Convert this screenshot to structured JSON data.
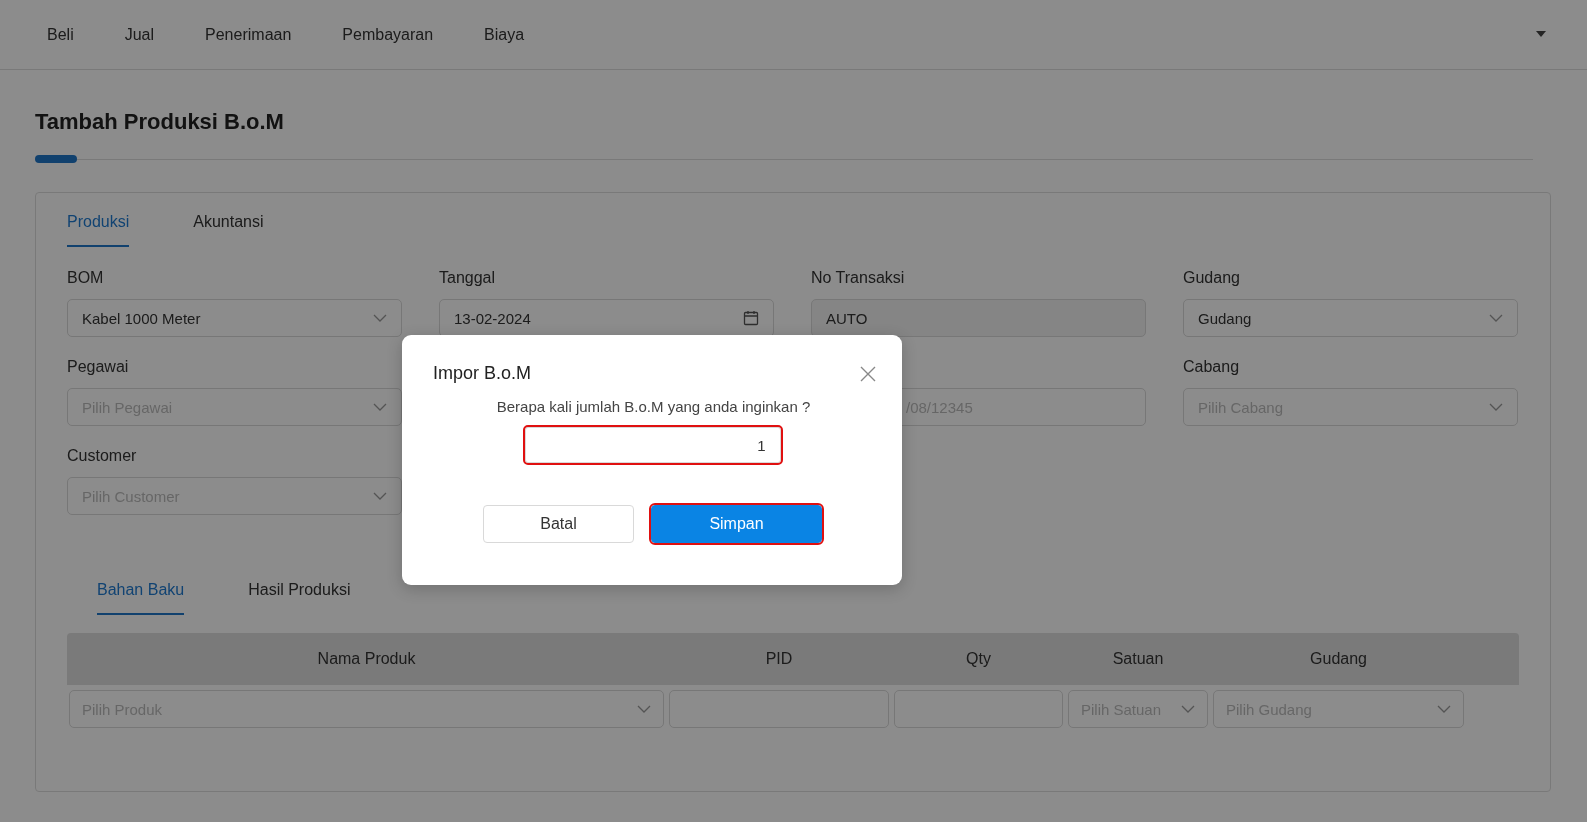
{
  "nav": {
    "items": [
      "Beli",
      "Jual",
      "Penerimaan",
      "Pembayaran",
      "Biaya"
    ]
  },
  "page": {
    "title": "Tambah Produksi B.o.M"
  },
  "form_tabs": [
    {
      "label": "Produksi",
      "selected": true
    },
    {
      "label": "Akuntansi",
      "selected": false
    }
  ],
  "field_rows": [
    [
      {
        "label": "BOM",
        "kind": "select",
        "value": "Kabel 1000 Meter"
      },
      {
        "label": "Tanggal",
        "kind": "date",
        "value": "13-02-2024"
      },
      {
        "label": "No Transaksi",
        "kind": "readonly",
        "value": "AUTO"
      },
      {
        "label": "Gudang",
        "kind": "select",
        "value": "Gudang"
      }
    ],
    [
      {
        "label": "Pegawai",
        "kind": "select",
        "placeholder": "Pilih Pegawai"
      },
      {
        "kind": "covered"
      },
      {
        "kind": "text",
        "placeholder": "/08/12345"
      },
      {
        "label": "Cabang",
        "kind": "select",
        "placeholder": "Pilih Cabang"
      }
    ],
    [
      {
        "label": "Customer",
        "kind": "select",
        "placeholder": "Pilih Customer"
      },
      {
        "kind": "covered"
      }
    ]
  ],
  "item_tabs": [
    {
      "label": "Bahan Baku",
      "selected": true
    },
    {
      "label": "Hasil Produksi",
      "selected": false
    }
  ],
  "table": {
    "columns": [
      "Nama Produk",
      "PID",
      "Qty",
      "Satuan",
      "Gudang"
    ],
    "input_row": [
      {
        "kind": "select",
        "placeholder": "Pilih Produk"
      },
      {
        "kind": "text"
      },
      {
        "kind": "text"
      },
      {
        "kind": "select",
        "placeholder": "Pilih Satuan"
      },
      {
        "kind": "select",
        "placeholder": "Pilih Gudang"
      }
    ]
  },
  "dialog": {
    "title": "Impor B.o.M",
    "question": "Berapa kali jumlah B.o.M yang anda inginkan ?",
    "input": {
      "value": "1",
      "highlighted": true
    },
    "buttons": [
      {
        "label": "Batal",
        "kind": "secondary",
        "highlighted": false
      },
      {
        "label": "Simpan",
        "kind": "primary",
        "highlighted": true
      }
    ]
  }
}
